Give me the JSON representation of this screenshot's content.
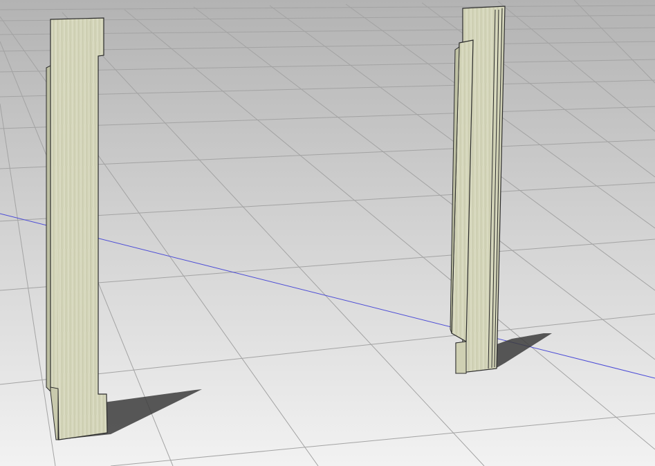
{
  "scene": {
    "background_top": "#b5b5b5",
    "background_bottom": "#f1f1f1",
    "grid_line_color": "#9a9a9a",
    "axis_line_color": "#4b4bd6",
    "wood_color": "#d7d8bf",
    "wood_shade_color": "#b9bb9f",
    "edge_color": "#2b2b2b",
    "shadow_color": "#3a3a3a"
  },
  "objects": [
    {
      "name": "left-wooden-post"
    },
    {
      "name": "right-wooden-post"
    }
  ]
}
